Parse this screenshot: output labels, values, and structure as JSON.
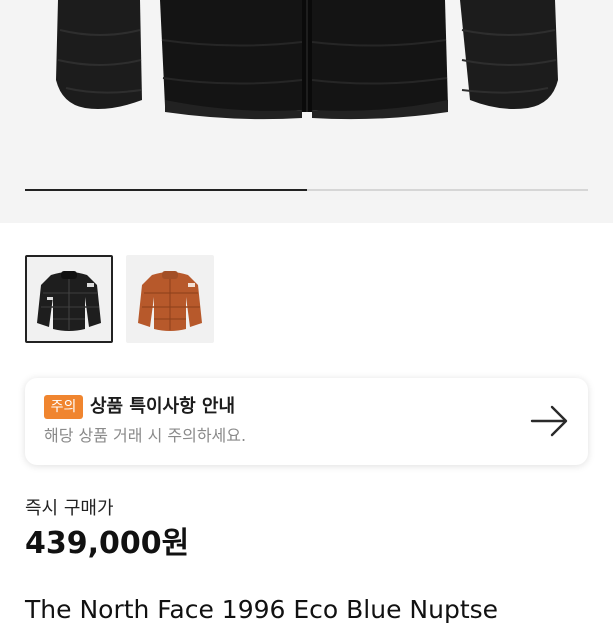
{
  "hero": {
    "image_description_icon": "black-puffer-jacket-image",
    "carousel_progress": 0.5
  },
  "thumbnails": [
    {
      "color_name": "black",
      "color": "#1e1e1e",
      "selected": true
    },
    {
      "color_name": "orange-brown",
      "color": "#b7592b",
      "selected": false
    }
  ],
  "notice": {
    "badge": "주의",
    "title": "상품 특이사항 안내",
    "subtitle": "해당 상품 거래 시 주의하세요.",
    "badge_color": "#f0852f",
    "arrow_icon": "arrow-right-icon"
  },
  "price": {
    "label": "즉시 구매가",
    "value": "439,000원"
  },
  "product": {
    "title": "The North Face 1996 Eco Blue Nuptse"
  }
}
